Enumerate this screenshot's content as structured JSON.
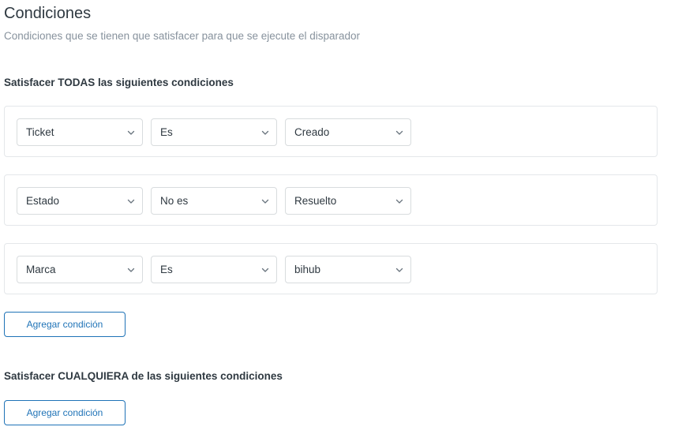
{
  "header": {
    "title": "Condiciones",
    "subtitle": "Condiciones que se tienen que satisfacer para que se ejecute el disparador"
  },
  "all_section": {
    "heading": "Satisfacer TODAS las siguientes condiciones",
    "conditions": [
      {
        "field": "Ticket",
        "operator": "Es",
        "value": "Creado"
      },
      {
        "field": "Estado",
        "operator": "No es",
        "value": "Resuelto"
      },
      {
        "field": "Marca",
        "operator": "Es",
        "value": "bihub"
      }
    ],
    "add_label": "Agregar condición"
  },
  "any_section": {
    "heading": "Satisfacer CUALQUIERA de las siguientes condiciones",
    "add_label": "Agregar condición"
  },
  "icons": {
    "dropdown": "chevron-down-icon"
  },
  "colors": {
    "accent": "#1f73b7",
    "border": "#d8dcde",
    "muted_text": "#87929d"
  }
}
